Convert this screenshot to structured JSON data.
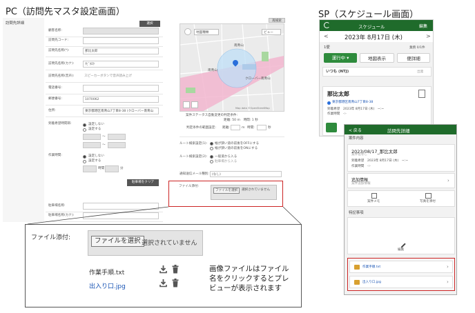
{
  "headings": {
    "pc": "PC（訪問先マスタ設定画面）",
    "sp": "SP（スケジュール画面）"
  },
  "pc": {
    "section_title": "訪問先詳細",
    "top_button": "選択",
    "fields": [
      {
        "label": "顧客名称:",
        "value": ""
      },
      {
        "label": "訪問先コード:",
        "value": ""
      },
      {
        "label": "訪問先名称(*):",
        "value": "那比太郎"
      },
      {
        "label": "訪問先名称(カナ):",
        "value": "ﾅﾋﾞﾀﾛｳ"
      },
      {
        "label": "訪問先名称(音声):",
        "value": "スピーカーボタンで音声読み上げ"
      },
      {
        "label": "電話番号:",
        "value": ""
      },
      {
        "label": "郵便番号:",
        "value": "1070062"
      },
      {
        "label": "住所:",
        "value": "東京都港区南青山7丁目8-38 (クローバー南青山"
      },
      {
        "label": "到着希望時間帯:",
        "value": ""
      },
      {
        "label": "作業時間:",
        "value": ""
      },
      {
        "label": "駐車場名称:",
        "value": ""
      },
      {
        "label": "駐車場名称(カナ):",
        "value": ""
      }
    ],
    "arrival_options": [
      "設定しない",
      "設定する"
    ],
    "work_options": [
      "設定しない",
      "設定する"
    ],
    "tilde": "〜",
    "minute_unit": "分",
    "time_unit": "時間",
    "parking_button": "駐車場をクリア",
    "map": {
      "dropdown": "地図種類",
      "view_button": "ビュー",
      "top_right_label": "再検索",
      "place_1": "南青山",
      "place_2": "クローバー南青山",
      "place_3": "南青山",
      "attribution": "Map data ©OpenStreetMap",
      "status_text": "案件ステータス自動変更の判定条件:",
      "distance_text": "距離: 50 m　時間: 1 秒",
      "range_label": "判定条件の範囲設定:",
      "range_distance": "距離:",
      "range_distance_unit": "m",
      "range_time": "時間:",
      "range_time_unit": "秒"
    },
    "route_label_1": "ルート検索設定(1):",
    "route_options_1": [
      "幅が狭い道の前後をOFFにする",
      "幅が狭い道の前後をONにする"
    ],
    "route_label_2": "ルート検索設定(2):",
    "route_options_2": [
      "一般道から入る",
      "駐車場から入る"
    ],
    "notify_label": "通知送信メール種別:",
    "notify_value": "(なし)",
    "file_label": "ファイル添付:",
    "file_button": "ファイルを選択",
    "file_none": "選択されていません"
  },
  "callout": {
    "file_label": "ファイル添付:",
    "file_button": "ファイルを選択",
    "file_none": "選択されていません",
    "files": [
      {
        "name": "作業手順.txt",
        "is_link": false
      },
      {
        "name": "出入り口.jpg",
        "is_link": true
      }
    ],
    "note_lines": [
      "画像ファイルはファイル",
      "名をクリックするとプレ",
      "ビューが表示されます"
    ]
  },
  "sp": {
    "back": {
      "title": "スケジュール",
      "edit": "編集",
      "date": "2023年 8月17日 (木)",
      "prev": "<",
      "next": ">",
      "route_label": "1便",
      "count_label": "業務 0/1件",
      "tabs": [
        "運行中 ▾",
        "地図表示",
        "便詳細"
      ],
      "section": "いつも (NTJ)",
      "section_right": "出発",
      "visit_name": "那比太郎",
      "address": "東京都港区南青山7丁目8-38",
      "wish": "到着希望　2023年 8月17日 (木)　~:~",
      "work": "作業時間　-:-"
    },
    "front": {
      "back": "< 戻る",
      "title": "訪問先詳細",
      "section": "案件内容",
      "case_name": "2023/08/17_那比太郎",
      "case_sub": "案件名なし",
      "wish": "到着希望　2023年 8月17日 (木)　~:~",
      "work": "作業時間　-:-",
      "extra": "追加情報",
      "extra_sub": "案件追加情報",
      "icon_btn_1": "案件メモ",
      "icon_btn_2": "写真を添付",
      "special": "特記事項",
      "edit_label": "編集",
      "files": [
        "作業手順.txt",
        "出入り口.jpg"
      ]
    }
  },
  "colors": {
    "sp_green": "#1f6b2b",
    "highlight_red": "#cc2222",
    "link_blue": "#1a55b5"
  }
}
